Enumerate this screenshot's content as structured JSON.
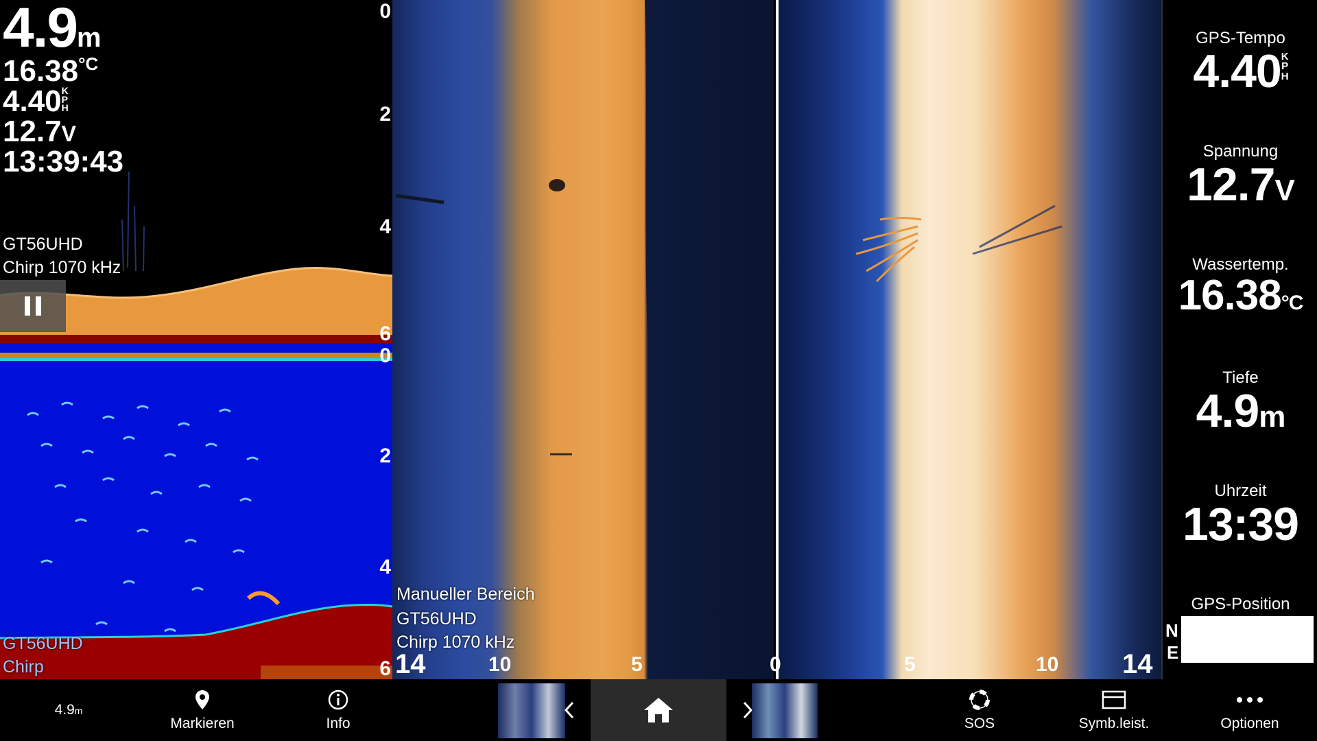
{
  "overlay_readouts": {
    "depth_value": "4.9",
    "depth_unit": "m",
    "temp_value": "16.38",
    "temp_unit": "°C",
    "speed_value": "4.40",
    "speed_unit_letters": [
      "K",
      "P",
      "H"
    ],
    "voltage_value": "12.7",
    "voltage_unit": "V",
    "time_value": "13:39:43"
  },
  "top_left_pane": {
    "transducer": "GT56UHD",
    "frequency": "Chirp 1070 kHz",
    "depth_scale": [
      "0",
      "2",
      "4",
      "6"
    ]
  },
  "bottom_left_pane": {
    "transducer": "GT56UHD",
    "mode": "Chirp",
    "depth_scale": [
      "0",
      "2",
      "4",
      "6"
    ]
  },
  "downscan_pane": {
    "range_mode": "Manueller Bereich",
    "transducer": "GT56UHD",
    "frequency": "Chirp 1070 kHz",
    "scale_labels": [
      "14",
      "10",
      "5"
    ]
  },
  "sidescan_pane": {
    "scale_labels": [
      "0",
      "5",
      "10",
      "14"
    ]
  },
  "sidebar": {
    "fields": [
      {
        "label": "GPS-Tempo",
        "value": "4.40",
        "unit_letters": [
          "K",
          "P",
          "H"
        ]
      },
      {
        "label": "Spannung",
        "value": "12.7",
        "unit": "V"
      },
      {
        "label": "Wassertemp.",
        "value": "16.38",
        "unit": "°C"
      },
      {
        "label": "Tiefe",
        "value": "4.9",
        "unit": "m"
      },
      {
        "label": "Uhrzeit",
        "value": "13:39"
      },
      {
        "label": "GPS-Position",
        "lat_prefix": "N",
        "lon_prefix": "E"
      }
    ]
  },
  "toolbar": {
    "depth_value": "4.9",
    "depth_unit": "m",
    "mark_label": "Markieren",
    "info_label": "Info",
    "sos_label": "SOS",
    "toolbar_label": "Symb.leist.",
    "options_label": "Optionen"
  },
  "colors": {
    "sonar_orange": "#e89a46",
    "sonar_blue": "#1e3f96",
    "color_sonar_bg": "#0010d8",
    "bottom_red": "#9a0000"
  }
}
